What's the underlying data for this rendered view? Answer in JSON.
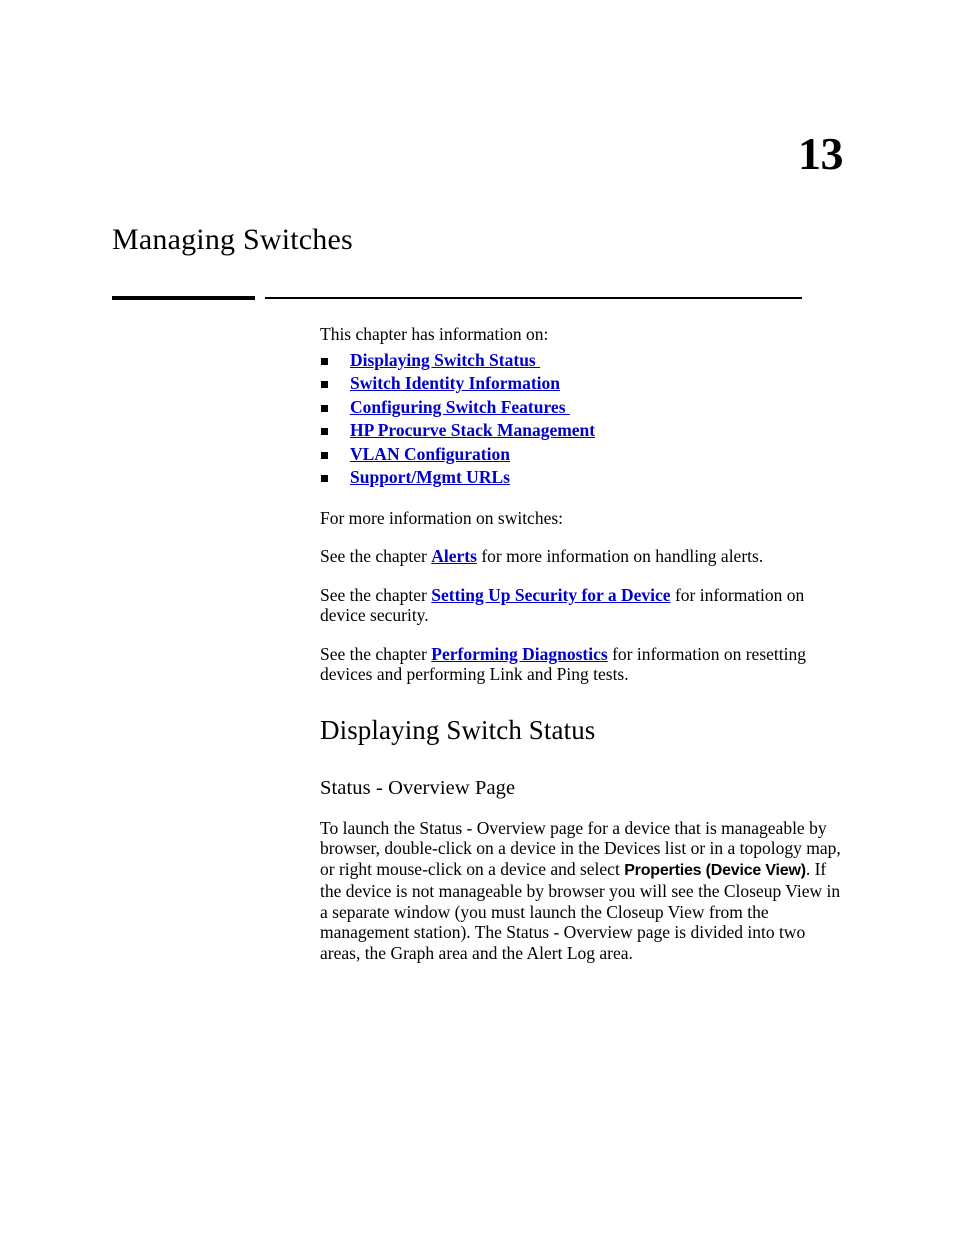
{
  "page": {
    "chapter_number": "13",
    "chapter_title": "Managing Switches"
  },
  "intro": {
    "lead": "This chapter has information on:",
    "links": [
      {
        "label": "Displaying Switch Status "
      },
      {
        "label": "Switch Identity Information"
      },
      {
        "label": "Configuring Switch Features "
      },
      {
        "label": "HP Procurve Stack Management"
      },
      {
        "label": "VLAN Configuration"
      },
      {
        "label": "Support/Mgmt URLs"
      }
    ],
    "more_info_lead": "For more information on switches:",
    "cross_references": [
      {
        "before": "See the chapter ",
        "link": "Alerts",
        "after": " for more information on handling alerts."
      },
      {
        "before": "See the chapter ",
        "link": "Setting Up Security for a Device",
        "after": " for information on device security."
      },
      {
        "before": "See the chapter ",
        "link": "Performing Diagnostics",
        "after": " for information on resetting devices and performing Link and Ping tests."
      }
    ]
  },
  "sections": {
    "heading_1": "Displaying Switch Status",
    "heading_2": "Status - Overview Page",
    "overview_paragraph": {
      "part_1": "To launch the Status - Overview page for a device that is manageable by browser, double-click on a device in the Devices list or in a topology map, or right mouse-click on a device and select ",
      "emphasis": "Properties (Device View)",
      "part_2": ". If the device is not manageable by browser you will see the Closeup View in a separate window (you must launch the Closeup View from the management station). The Status - Overview page is divided into two areas, the Graph area and the Alert Log area."
    }
  },
  "style": {
    "link_color": "#0000cd",
    "text_color": "#000000",
    "background": "#ffffff"
  }
}
